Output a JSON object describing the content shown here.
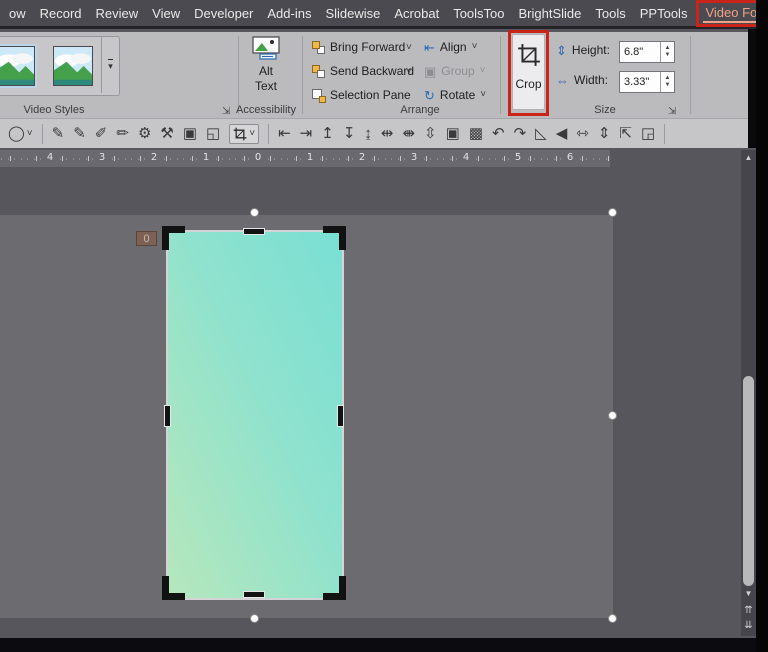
{
  "menu": {
    "tabs": [
      "ow",
      "Record",
      "Review",
      "View",
      "Developer",
      "Add-ins",
      "Slidewise",
      "Acrobat",
      "ToolsToo",
      "BrightSlide",
      "Tools",
      "PPTools"
    ],
    "active_tab": "Video Format"
  },
  "ribbon": {
    "video_styles": {
      "label": "Video Styles"
    },
    "accessibility": {
      "label": "Accessibility",
      "alt_text_label": "Alt Text"
    },
    "arrange": {
      "label": "Arrange",
      "bring_forward": "Bring Forward",
      "send_backward": "Send Backward",
      "selection_pane": "Selection Pane",
      "align": "Align",
      "group": "Group",
      "rotate": "Rotate",
      "icons": {
        "align": "⇤",
        "group": "▣",
        "rotate": "↻"
      }
    },
    "crop": {
      "label": "Crop"
    },
    "size": {
      "label": "Size",
      "height_label": "Height:",
      "height_value": "6.8\"",
      "width_label": "Width:",
      "width_value": "3.33\"",
      "height_icon": "⇕",
      "width_icon": "⇔"
    }
  },
  "ui": {
    "chevron_down": "˅",
    "more_glyph": "▾",
    "dialog_launcher": "⇲",
    "spinner_up": "▲",
    "spinner_down": "▼"
  },
  "toolbar": {
    "icons": [
      {
        "name": "oval-shape-tool-icon",
        "glyph": "◯"
      },
      {
        "name": "shape-fill-icon",
        "glyph": "✎"
      },
      {
        "name": "line-color-icon",
        "glyph": "✎"
      },
      {
        "name": "pen-style-icon",
        "glyph": "✐"
      },
      {
        "name": "format-painter-icon",
        "glyph": "✏"
      },
      {
        "name": "style-tools-icon",
        "glyph": "⚙"
      },
      {
        "name": "build-tool-icon",
        "glyph": "⚒"
      },
      {
        "name": "group-objects-icon",
        "glyph": "▣"
      },
      {
        "name": "ungroup-objects-icon",
        "glyph": "◱"
      },
      {
        "name": "crop-tool-icon",
        "glyph": ""
      },
      {
        "name": "align-left-icon",
        "glyph": "⇤"
      },
      {
        "name": "align-right-icon",
        "glyph": "⇥"
      },
      {
        "name": "align-top-icon",
        "glyph": "↥"
      },
      {
        "name": "align-bottom-icon",
        "glyph": "↧"
      },
      {
        "name": "align-center-icon",
        "glyph": "↨"
      },
      {
        "name": "distribute-horizontal-icon",
        "glyph": "⇹"
      },
      {
        "name": "distribute-vertical-icon",
        "glyph": "⇼"
      },
      {
        "name": "align-middle-icon",
        "glyph": "⇳"
      },
      {
        "name": "bring-forward-icon",
        "glyph": "▣"
      },
      {
        "name": "send-backward-icon",
        "glyph": "▩"
      },
      {
        "name": "rotate-left-icon",
        "glyph": "↶"
      },
      {
        "name": "rotate-right-icon",
        "glyph": "↷"
      },
      {
        "name": "flip-vertical-icon",
        "glyph": "◺"
      },
      {
        "name": "flip-horizontal-icon",
        "glyph": "◀"
      },
      {
        "name": "resize-width-icon",
        "glyph": "⇿"
      },
      {
        "name": "resize-height-icon",
        "glyph": "⇕"
      },
      {
        "name": "pointer-select-icon",
        "glyph": "⇱"
      },
      {
        "name": "scale-fit-icon",
        "glyph": "◲"
      }
    ]
  },
  "ruler": {
    "numbers": [
      "4",
      "3",
      "2",
      "1",
      "0",
      "1",
      "2",
      "3",
      "4",
      "5",
      "6"
    ]
  },
  "canvas": {
    "marker_label": "0"
  },
  "scrollbar": {
    "up_glyph": "▲",
    "down_glyph": "▼",
    "prev_glyph": "⇈",
    "next_glyph": "⇊"
  },
  "annotation_color": "#c9241a",
  "video": {
    "gradient_start": "#79dfd4",
    "gradient_end": "#b6e7bc"
  }
}
